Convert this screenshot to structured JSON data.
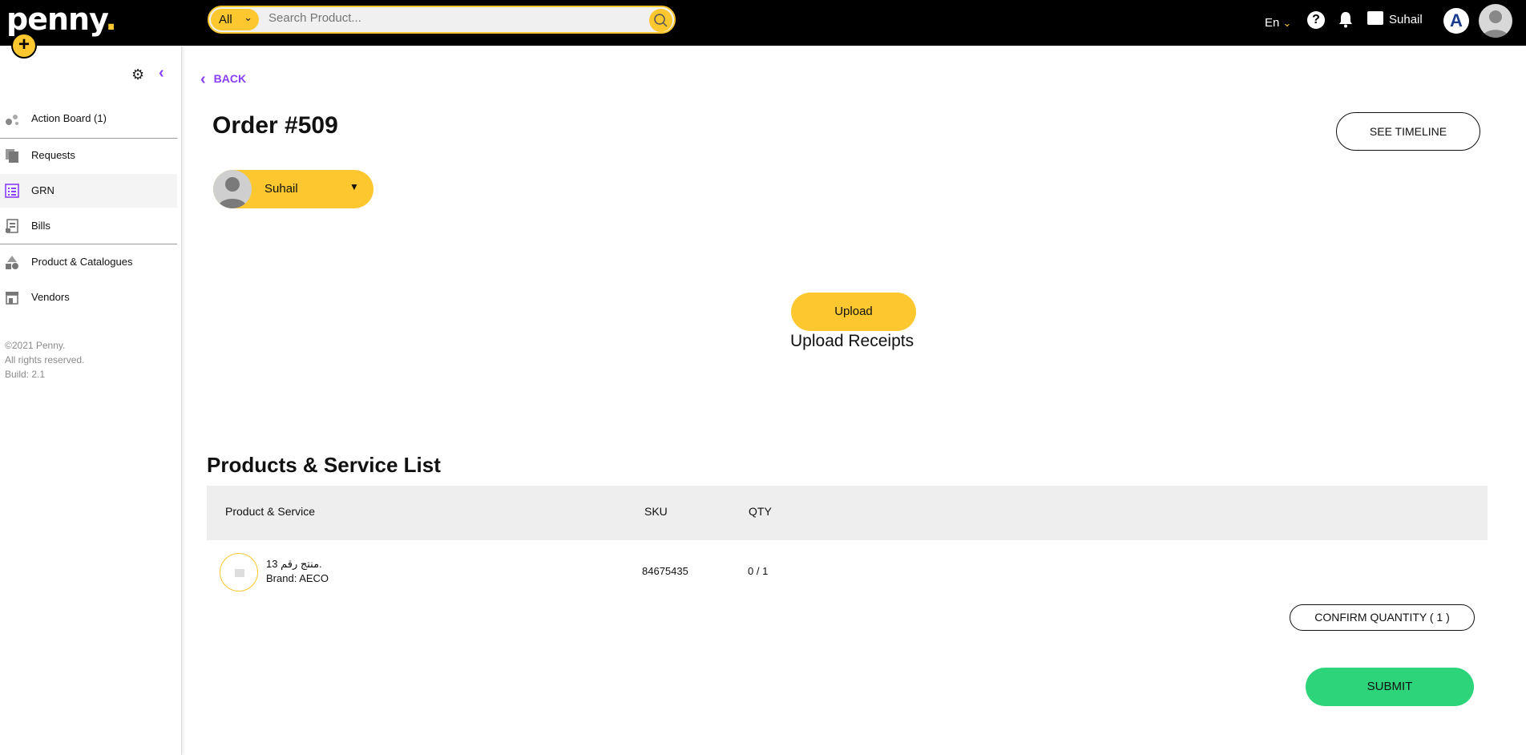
{
  "topbar": {
    "logo": "penny",
    "add_button": "+",
    "search": {
      "scope": "All",
      "placeholder": "Search Product..."
    },
    "language": "En",
    "help": "?",
    "username": "Suhail"
  },
  "sidebar": {
    "items": [
      {
        "label": "Action Board (1)",
        "icon": "action-board-icon"
      },
      {
        "label": "Requests",
        "icon": "requests-icon"
      },
      {
        "label": "GRN",
        "icon": "grn-icon",
        "active": true
      },
      {
        "label": "Bills",
        "icon": "bills-icon"
      },
      {
        "label": "Product & Catalogues",
        "icon": "catalogue-icon"
      },
      {
        "label": "Vendors",
        "icon": "vendors-icon"
      }
    ],
    "footer": [
      "©2021 Penny.",
      "All rights reserved.",
      "Build: 2.1"
    ]
  },
  "main": {
    "back": "BACK",
    "order_title": "Order #509",
    "see_timeline": "SEE TIMELINE",
    "assignee": "Suhail",
    "upload_button": "Upload",
    "upload_caption": "Upload Receipts",
    "section_title": "Products & Service List",
    "table": {
      "headers": [
        "Product & Service",
        "SKU",
        "QTY"
      ],
      "rows": [
        {
          "name": "منتج رقم 13.",
          "brand": "Brand: AECO",
          "sku": "84675435",
          "qty": "0 / 1"
        }
      ]
    },
    "confirm_button": "CONFIRM QUANTITY ( 1 )",
    "submit_button": "SUBMIT"
  },
  "colors": {
    "accent": "#fdc82f",
    "purple": "#8a3ffc",
    "submit": "#2ed47a",
    "topbar": "#000000"
  }
}
